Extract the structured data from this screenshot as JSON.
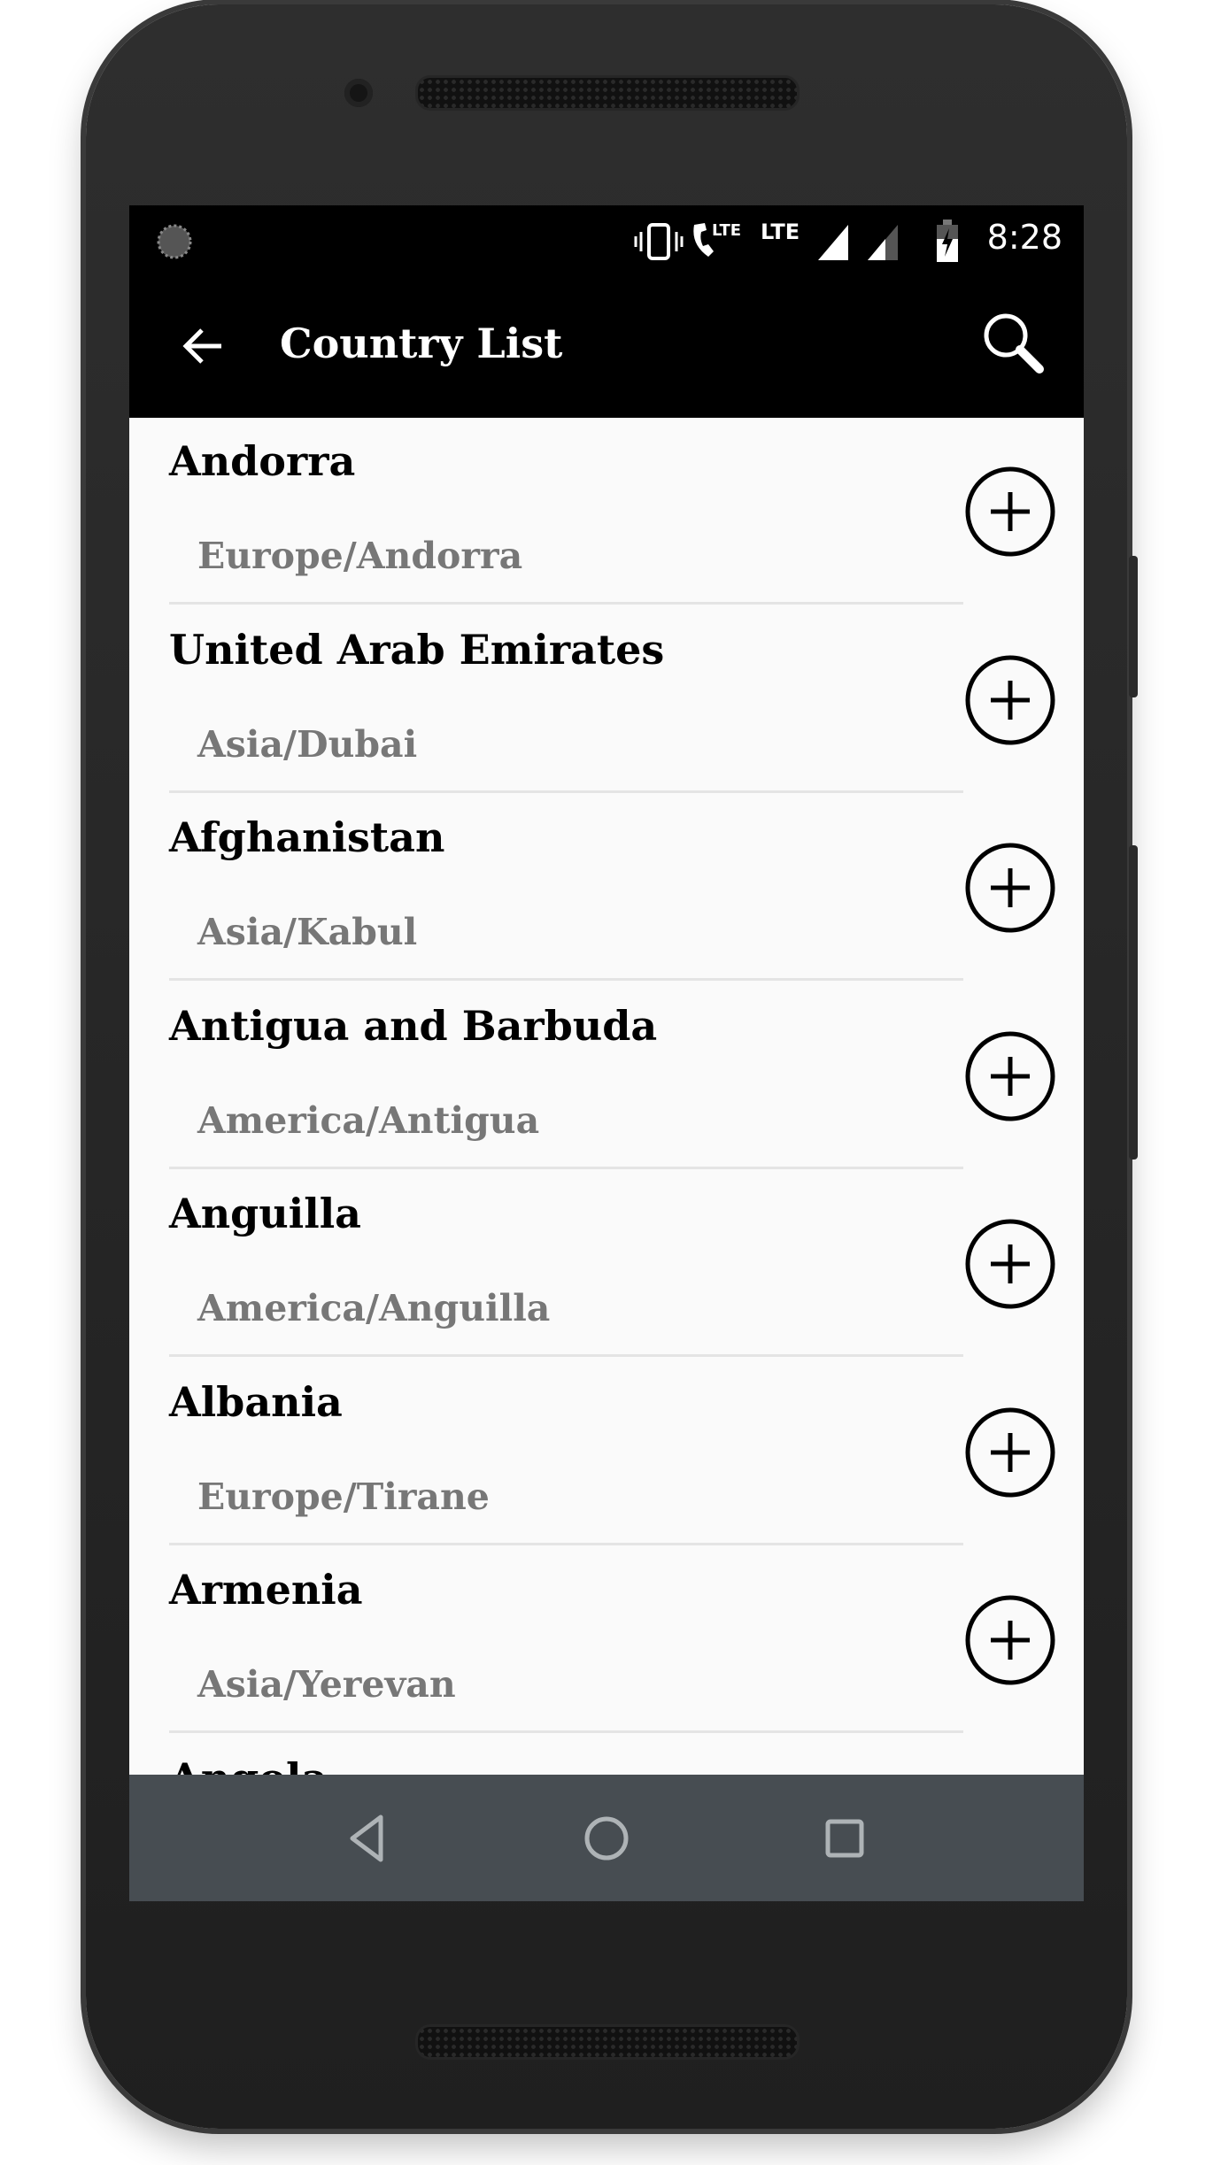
{
  "status_bar": {
    "time": "8:28",
    "icons": [
      "sync-icon",
      "vibrate-icon",
      "lte-call-icon",
      "lte-icon",
      "signal-full-icon",
      "signal-partial-icon",
      "battery-charging-icon"
    ],
    "lte_label": "LTE"
  },
  "toolbar": {
    "title": "Country List",
    "back_icon": "arrow-left-icon",
    "search_icon": "search-icon"
  },
  "countries": [
    {
      "name": "Andorra",
      "zone": "Europe/Andorra"
    },
    {
      "name": "United Arab Emirates",
      "zone": "Asia/Dubai"
    },
    {
      "name": "Afghanistan",
      "zone": "Asia/Kabul"
    },
    {
      "name": "Antigua and Barbuda",
      "zone": "America/Antigua"
    },
    {
      "name": "Anguilla",
      "zone": "America/Anguilla"
    },
    {
      "name": "Albania",
      "zone": "Europe/Tirane"
    },
    {
      "name": "Armenia",
      "zone": "Asia/Yerevan"
    },
    {
      "name": "Angola",
      "zone": ""
    }
  ],
  "nav_bar": {
    "icons": [
      "back-triangle-icon",
      "home-circle-icon",
      "recents-square-icon"
    ]
  },
  "colors": {
    "toolbar": "#000000",
    "list_bg": "#fafafa",
    "zone_text": "#777777",
    "nav_bar": "#474d52"
  }
}
